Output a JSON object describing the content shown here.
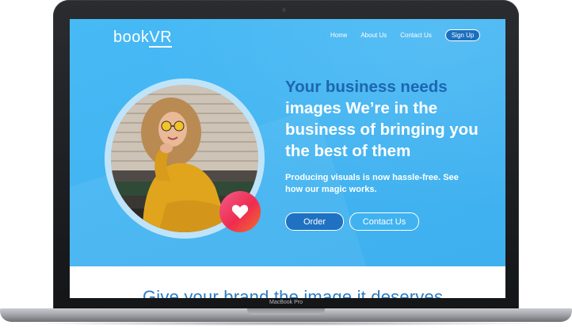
{
  "device": {
    "model_label": "MacBook Pro"
  },
  "nav": {
    "logo_book": "book",
    "logo_vr": "VR",
    "links": [
      "Home",
      "About Us",
      "Contact Us"
    ],
    "signup_label": "Sign Up"
  },
  "hero": {
    "headline_line1": "Your business needs",
    "headline_rest": "images We’re in the business of bringing you the best of them",
    "subtext": "Producing visuals is now hassle-free. See how our magic works.",
    "order_label": "Order",
    "contact_label": "Contact Us",
    "badge_icon": "heart-icon"
  },
  "section2": {
    "heading": "Give your brand the image it deserves"
  },
  "colors": {
    "hero_bg": "#44b8f4",
    "accent_dark_blue": "#1d66b0",
    "heading_blue": "#2c7cc6",
    "badge_gradient_start": "#f15d8a",
    "badge_gradient_end": "#f4702d"
  }
}
